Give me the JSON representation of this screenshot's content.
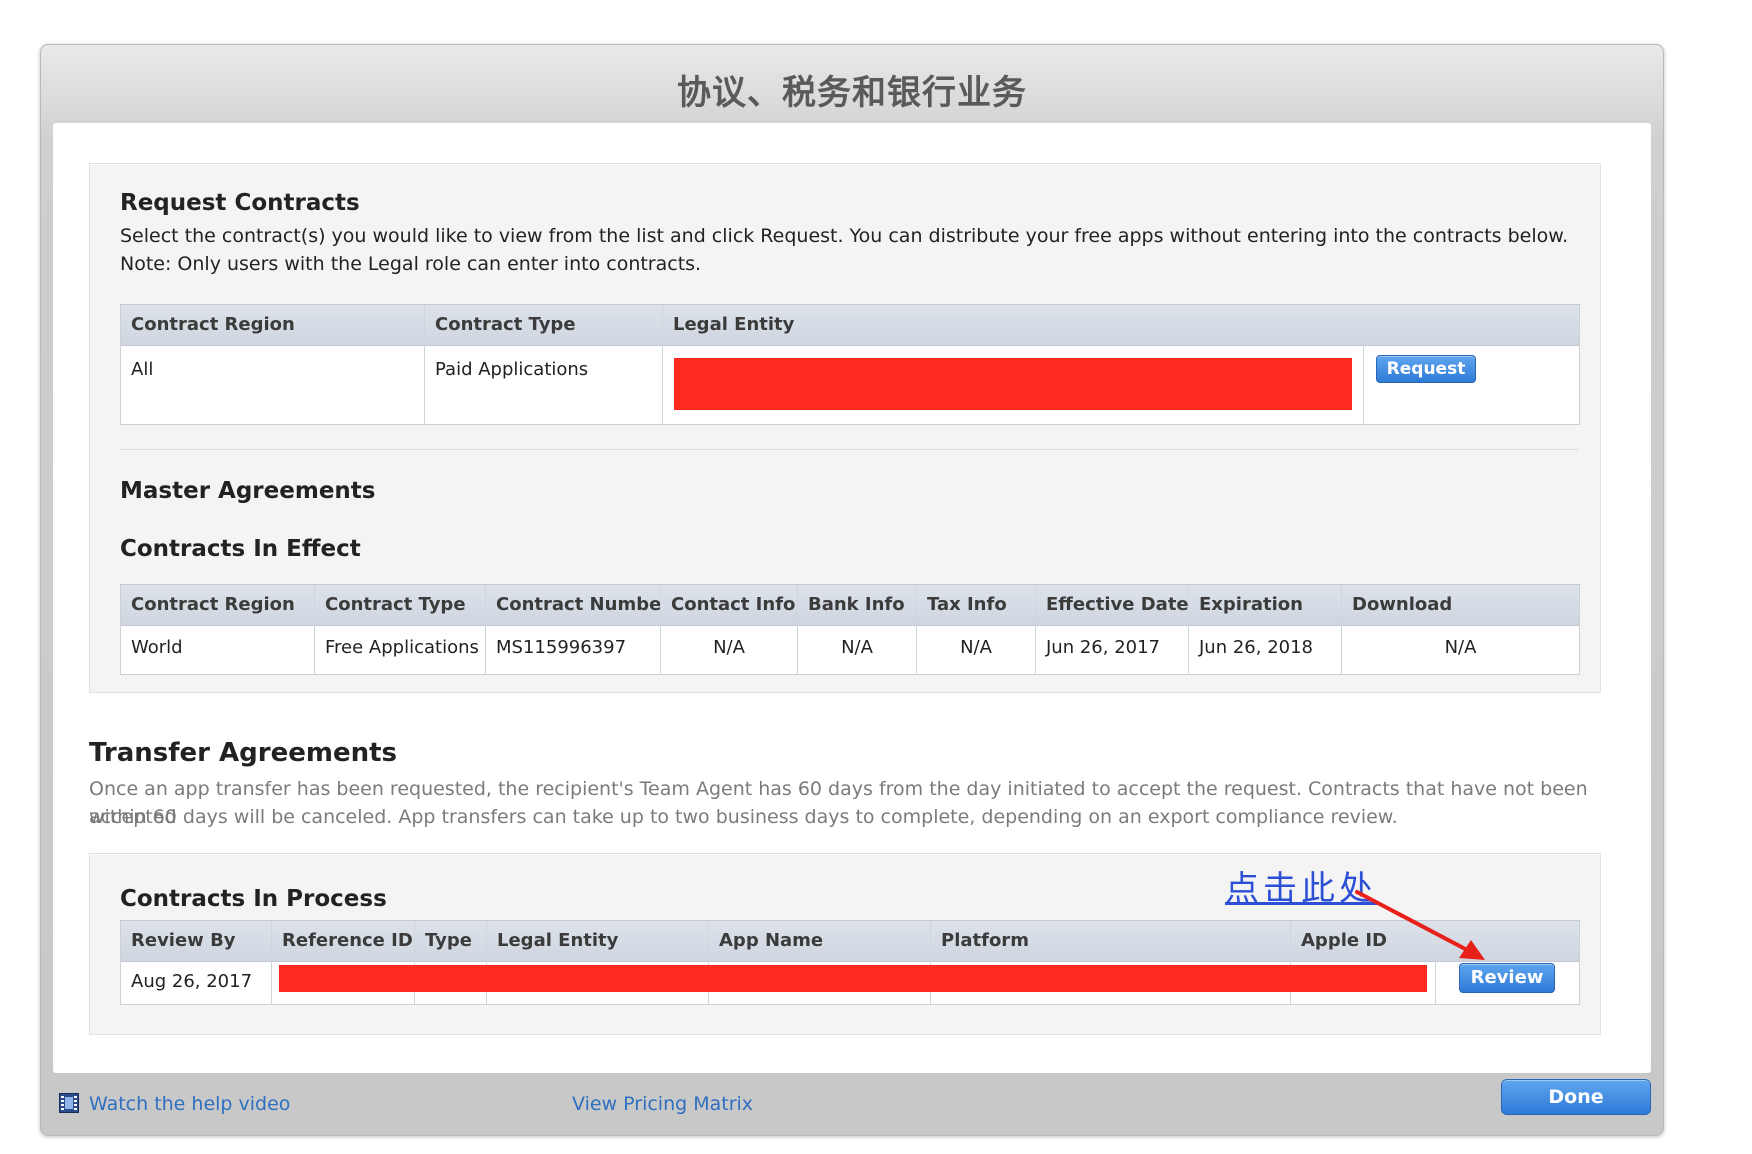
{
  "dialog": {
    "title": "协议、税务和银行业务"
  },
  "request_contracts": {
    "title": "Request Contracts",
    "desc_line1": "Select the contract(s) you would like to view from the list and click Request. You can distribute your free apps without entering into the contracts below.",
    "desc_line2": "Note: Only users with the Legal role can enter into contracts.",
    "headers": {
      "region": "Contract Region",
      "type": "Contract Type",
      "entity": "Legal Entity"
    },
    "row": {
      "region": "All",
      "type": "Paid Applications"
    },
    "request_button": "Request"
  },
  "master_agreements": {
    "title": "Master Agreements"
  },
  "contracts_in_effect": {
    "title": "Contracts In Effect",
    "headers": {
      "region": "Contract Region",
      "type": "Contract Type",
      "number": "Contract Number",
      "contact": "Contact Info",
      "bank": "Bank Info",
      "tax": "Tax Info",
      "effective": "Effective Date",
      "expiration": "Expiration",
      "download": "Download"
    },
    "row": {
      "region": "World",
      "type": "Free Applications",
      "number": "MS115996397",
      "contact": "N/A",
      "bank": "N/A",
      "tax": "N/A",
      "effective": "Jun 26, 2017",
      "expiration": "Jun 26, 2018",
      "download": "N/A"
    }
  },
  "transfer_agreements": {
    "title": "Transfer Agreements",
    "desc_line1": "Once an app transfer has been requested, the recipient's Team Agent has 60 days from the day initiated to accept the request. Contracts that have not been accepted",
    "desc_line2": "within 60 days will be canceled. App transfers can take up to two business days to complete, depending on an export compliance review."
  },
  "contracts_in_process": {
    "title": "Contracts In Process",
    "headers": {
      "review_by": "Review By",
      "ref_id": "Reference ID",
      "type": "Type",
      "entity": "Legal Entity",
      "app_name": "App Name",
      "platform": "Platform",
      "apple_id": "Apple ID"
    },
    "row": {
      "review_by": "Aug 26, 2017"
    },
    "review_button": "Review"
  },
  "annotation": {
    "text": "点击此处",
    "color": "#2d4fd6",
    "arrow_color": "#e8201a"
  },
  "footer": {
    "help_video": "Watch the help video",
    "pricing_matrix": "View Pricing Matrix",
    "done_button": "Done"
  },
  "colors": {
    "accent": "#2f7ad8",
    "redaction": "#ff2a1f",
    "link": "#2f6fc0"
  },
  "icons": {
    "help_video": "film-strip-icon"
  }
}
